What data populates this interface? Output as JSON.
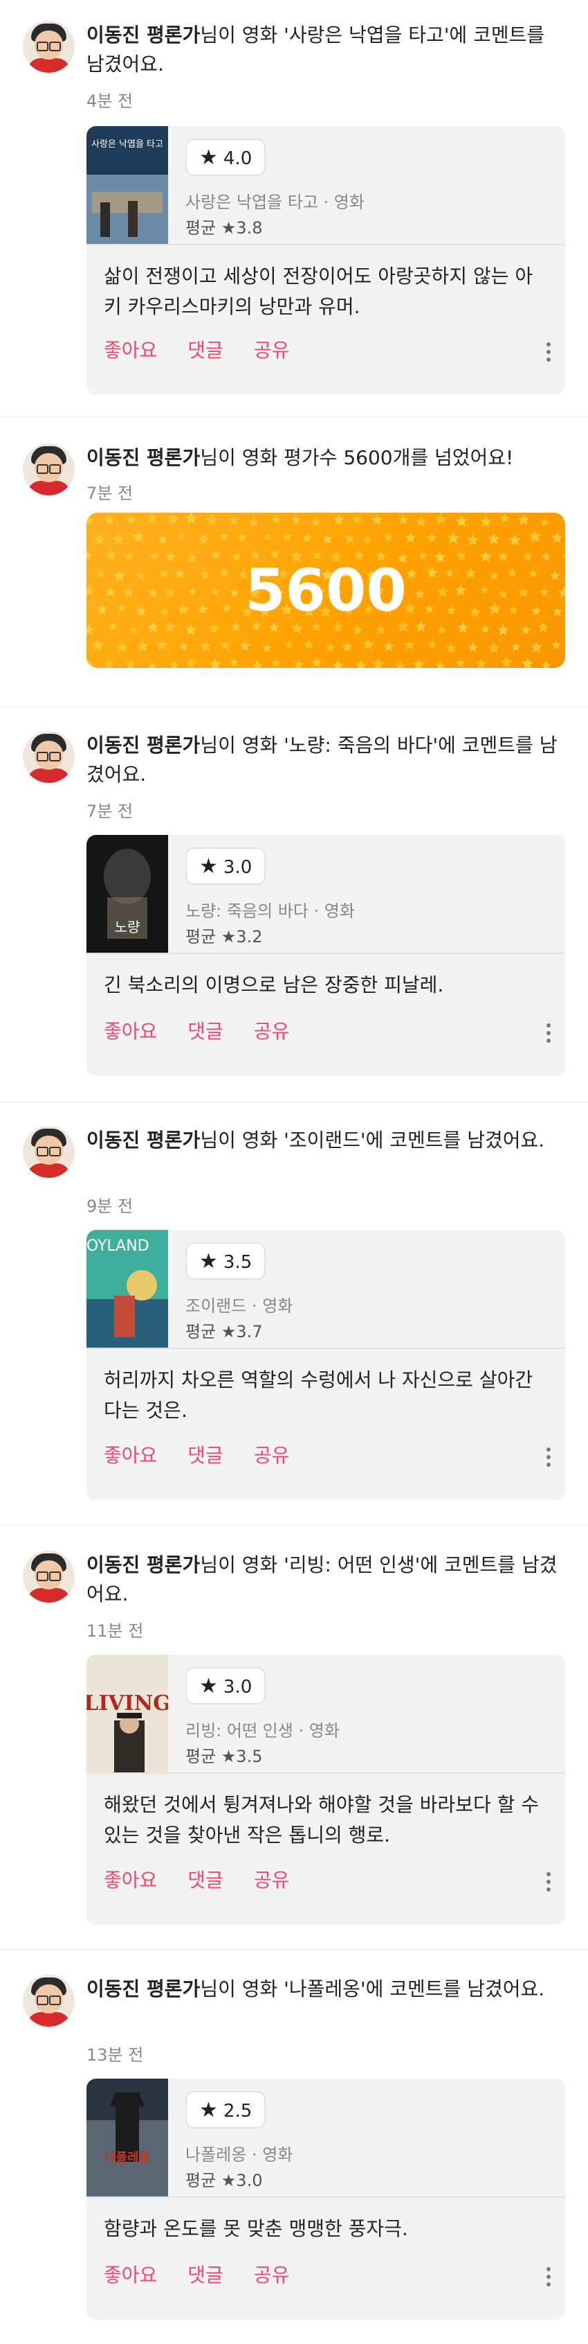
{
  "feed": [
    {
      "kind": "comment",
      "author": "이동진 평론가",
      "headline_rest": "님이 영화 '사랑은 낙엽을 타고'에 코멘트를 남겼어요.",
      "time": "4분 전",
      "rating": "4.0",
      "movie_meta": "사랑은 낙엽을 타고 · 영화",
      "average": "평균 ★3.8",
      "comment": "삶이 전쟁이고 세상이 전장이어도 아랑곳하지 않는 아키 카우리스마키의 낭만과 유머.",
      "actions": [
        "좋아요",
        "댓글",
        "공유"
      ],
      "poster": {
        "title_text": "사랑은 낙엽을 타고",
        "colors": [
          "#1f3b5a",
          "#6b8aa6",
          "#c9a36a"
        ]
      }
    },
    {
      "kind": "milestone",
      "author": "이동진 평론가",
      "headline_rest": "님이 영화 평가수 5600개를 넘었어요!",
      "time": "7분 전",
      "count": "5600"
    },
    {
      "kind": "comment",
      "author": "이동진 평론가",
      "headline_rest": "님이 영화 '노량: 죽음의 바다'에 코멘트를 남겼어요.",
      "time": "7분 전",
      "rating": "3.0",
      "movie_meta": "노량: 죽음의 바다 · 영화",
      "average": "평균 ★3.2",
      "comment": "긴 북소리의 이명으로 남은 장중한 피날레.",
      "actions": [
        "좋아요",
        "댓글",
        "공유"
      ],
      "poster": {
        "title_text": "노량",
        "colors": [
          "#151515",
          "#3a3a3a",
          "#8a8070"
        ]
      }
    },
    {
      "kind": "comment",
      "author": "이동진 평론가",
      "headline_rest": "님이 영화 '조이랜드'에 코멘트를 남겼어요.",
      "time": "9분 전",
      "rating": "3.5",
      "movie_meta": "조이랜드 · 영화",
      "average": "평균 ★3.7",
      "comment": "허리까지 차오른 역할의 수렁에서 나 자신으로 살아간다는 것은.",
      "actions": [
        "좋아요",
        "댓글",
        "공유"
      ],
      "poster": {
        "title_text": "JOYLAND",
        "colors": [
          "#3fae9b",
          "#e7c86a",
          "#2a5f7a"
        ]
      }
    },
    {
      "kind": "comment",
      "author": "이동진 평론가",
      "headline_rest": "님이 영화 '리빙: 어떤 인생'에 코멘트를 남겼어요.",
      "time": "11분 전",
      "rating": "3.0",
      "movie_meta": "리빙: 어떤 인생 · 영화",
      "average": "평균 ★3.5",
      "comment": "해왔던 것에서 튕겨져나와 해야할 것을 바라보다 할 수 있는 것을 찾아낸 작은 톱니의 행로.",
      "actions": [
        "좋아요",
        "댓글",
        "공유"
      ],
      "poster": {
        "title_text": "LIVING",
        "colors": [
          "#ece6d9",
          "#b0281e",
          "#2e2a25"
        ]
      }
    },
    {
      "kind": "comment",
      "author": "이동진 평론가",
      "headline_rest": "님이 영화 '나폴레옹'에 코멘트를 남겼어요.",
      "time": "13분 전",
      "rating": "2.5",
      "movie_meta": "나폴레옹 · 영화",
      "average": "평균 ★3.0",
      "comment": "함량과 온도를 못 맞춘 맹맹한 풍자극.",
      "actions": [
        "좋아요",
        "댓글",
        "공유"
      ],
      "poster": {
        "title_text": "나폴레옹",
        "colors": [
          "#2a3440",
          "#7b8a96",
          "#c2381f"
        ]
      }
    }
  ],
  "colors": {
    "accent": "#f0476b",
    "milestone": "#ffa200",
    "card_bg": "#f3f3f3"
  },
  "icons": {
    "rating": "star-icon",
    "more": "more-vertical-icon"
  }
}
